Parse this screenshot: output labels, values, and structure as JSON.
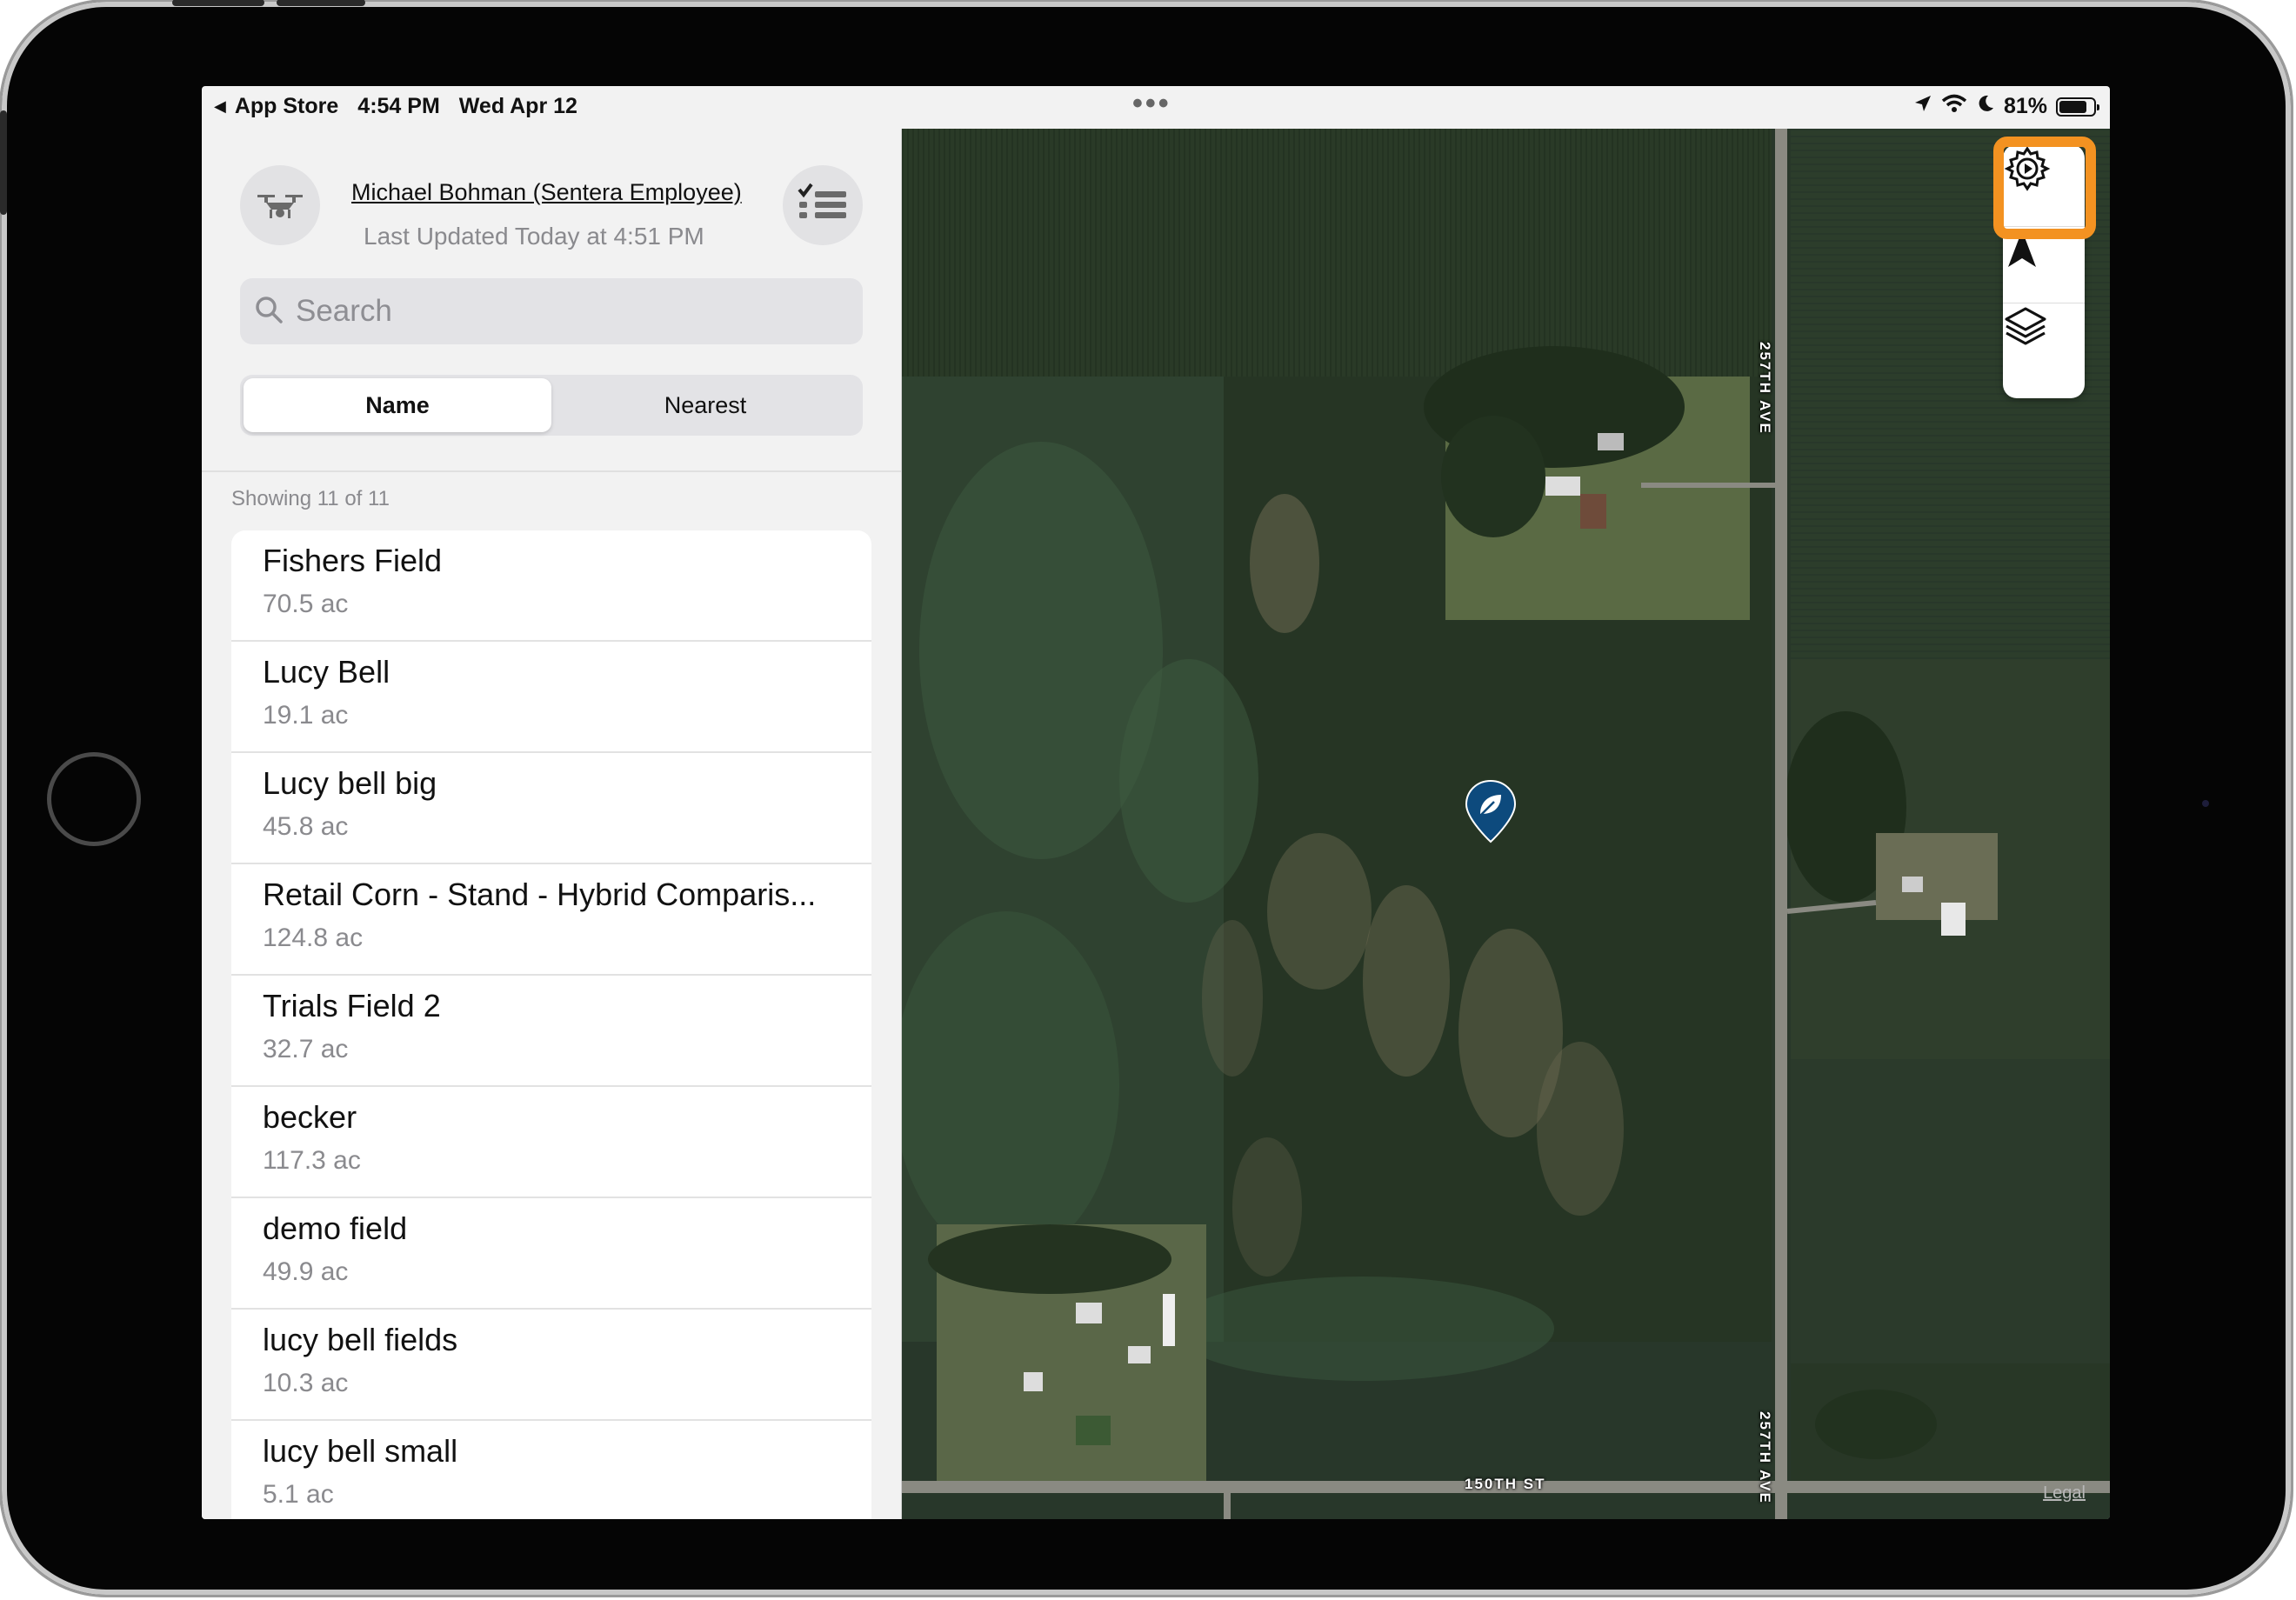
{
  "status_bar": {
    "back_label": "App Store",
    "time": "4:54 PM",
    "date": "Wed Apr 12",
    "battery": "81%",
    "battery_level": 0.81
  },
  "header": {
    "user_name": "Michael Bohman (Sentera Employee)",
    "last_updated": "Last Updated Today at 4:51 PM"
  },
  "search": {
    "placeholder": "Search",
    "value": ""
  },
  "sort": {
    "options": [
      "Name",
      "Nearest"
    ],
    "selected": "Name"
  },
  "showing": "Showing 11 of 11",
  "fields": [
    {
      "name": "Fishers Field",
      "area": "70.5 ac"
    },
    {
      "name": "Lucy Bell",
      "area": "19.1 ac"
    },
    {
      "name": "Lucy bell big",
      "area": "45.8 ac"
    },
    {
      "name": "Retail Corn - Stand - Hybrid Comparis...",
      "area": "124.8 ac"
    },
    {
      "name": "Trials Field 2",
      "area": "32.7 ac"
    },
    {
      "name": "becker",
      "area": "117.3 ac"
    },
    {
      "name": "demo field",
      "area": "49.9 ac"
    },
    {
      "name": "lucy bell fields",
      "area": "10.3 ac"
    },
    {
      "name": "lucy bell small",
      "area": "5.1 ac"
    }
  ],
  "map": {
    "road_labels": [
      "257TH AVE",
      "257TH AVE",
      "150TH ST"
    ],
    "legal": "Legal",
    "pin_icon": "leaf-icon",
    "controls": [
      "settings-icon",
      "navigation-arrow-icon",
      "layers-icon"
    ],
    "highlight_color": "#f39221"
  },
  "colors": {
    "pin": "#0d4a7d",
    "accent": "#f39221"
  }
}
